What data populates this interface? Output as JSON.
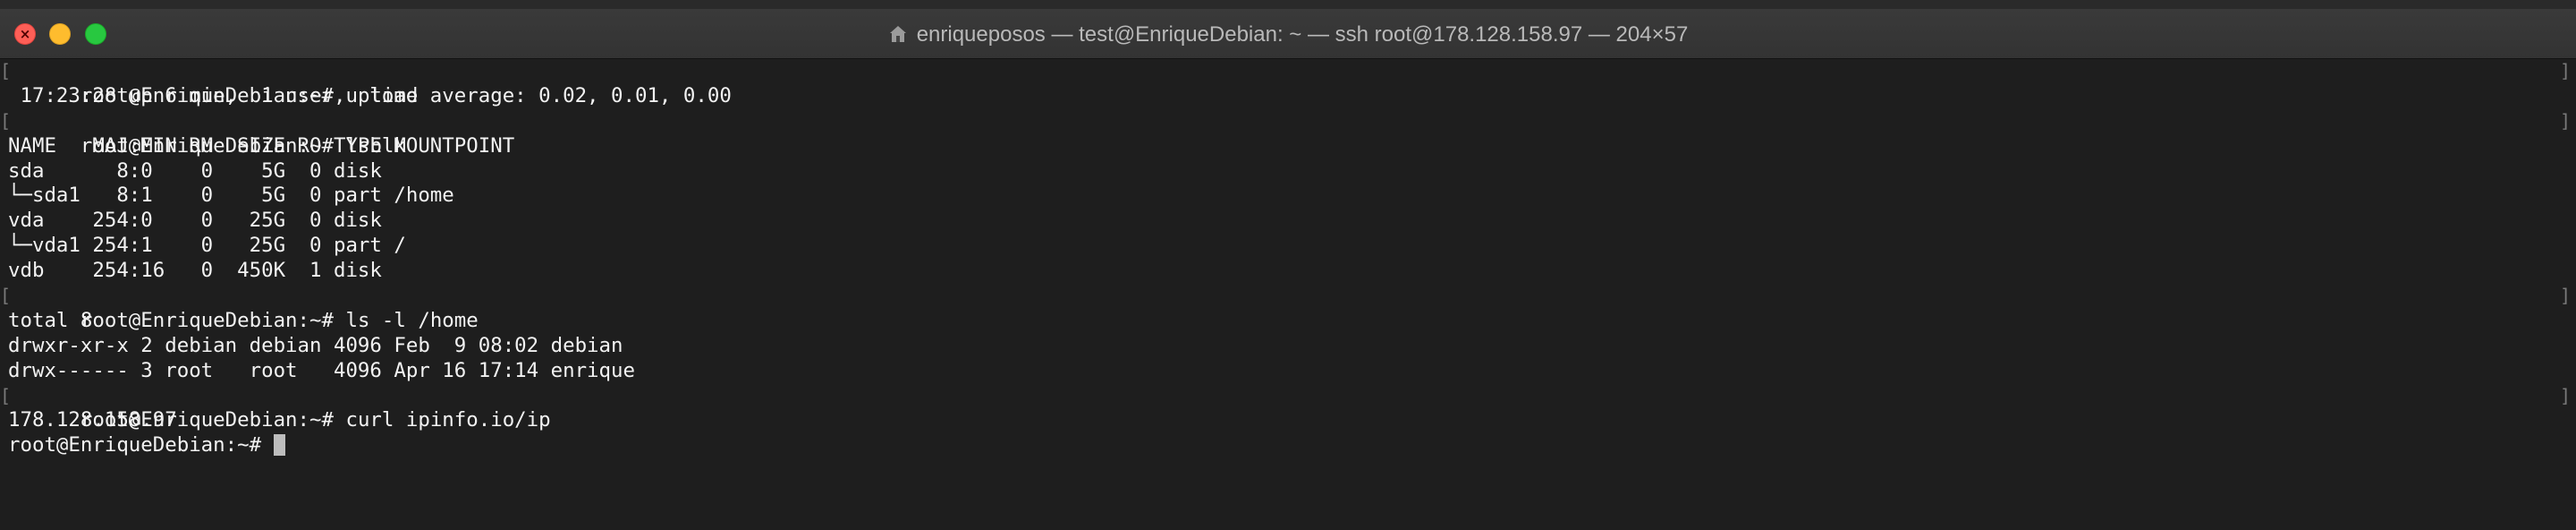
{
  "window": {
    "title": "enriqueposos — test@EnriqueDebian: ~ — ssh root@178.128.158.97 — 204×57",
    "close_glyph": "×"
  },
  "terminal": {
    "lines": [
      "root@EnriqueDebian:~# uptime",
      " 17:23:28 up 6 min,  1 user,  load average: 0.02, 0.01, 0.00",
      "root@EnriqueDebian:~# lsblk",
      "NAME   MAJ:MIN RM  SIZE RO TYPE MOUNTPOINT",
      "sda      8:0    0    5G  0 disk",
      "└─sda1   8:1    0    5G  0 part /home",
      "vda    254:0    0   25G  0 disk",
      "└─vda1 254:1    0   25G  0 part /",
      "vdb    254:16   0  450K  1 disk",
      "root@EnriqueDebian:~# ls -l /home",
      "total 8",
      "drwxr-xr-x 2 debian debian 4096 Feb  9 08:02 debian",
      "drwx------ 3 root   root   4096 Apr 16 17:14 enrique",
      "root@EnriqueDebian:~# curl ipinfo.io/ip",
      "178.128.158.97",
      "root@EnriqueDebian:~# "
    ],
    "marks": {
      "left": "[",
      "right": "]"
    }
  }
}
